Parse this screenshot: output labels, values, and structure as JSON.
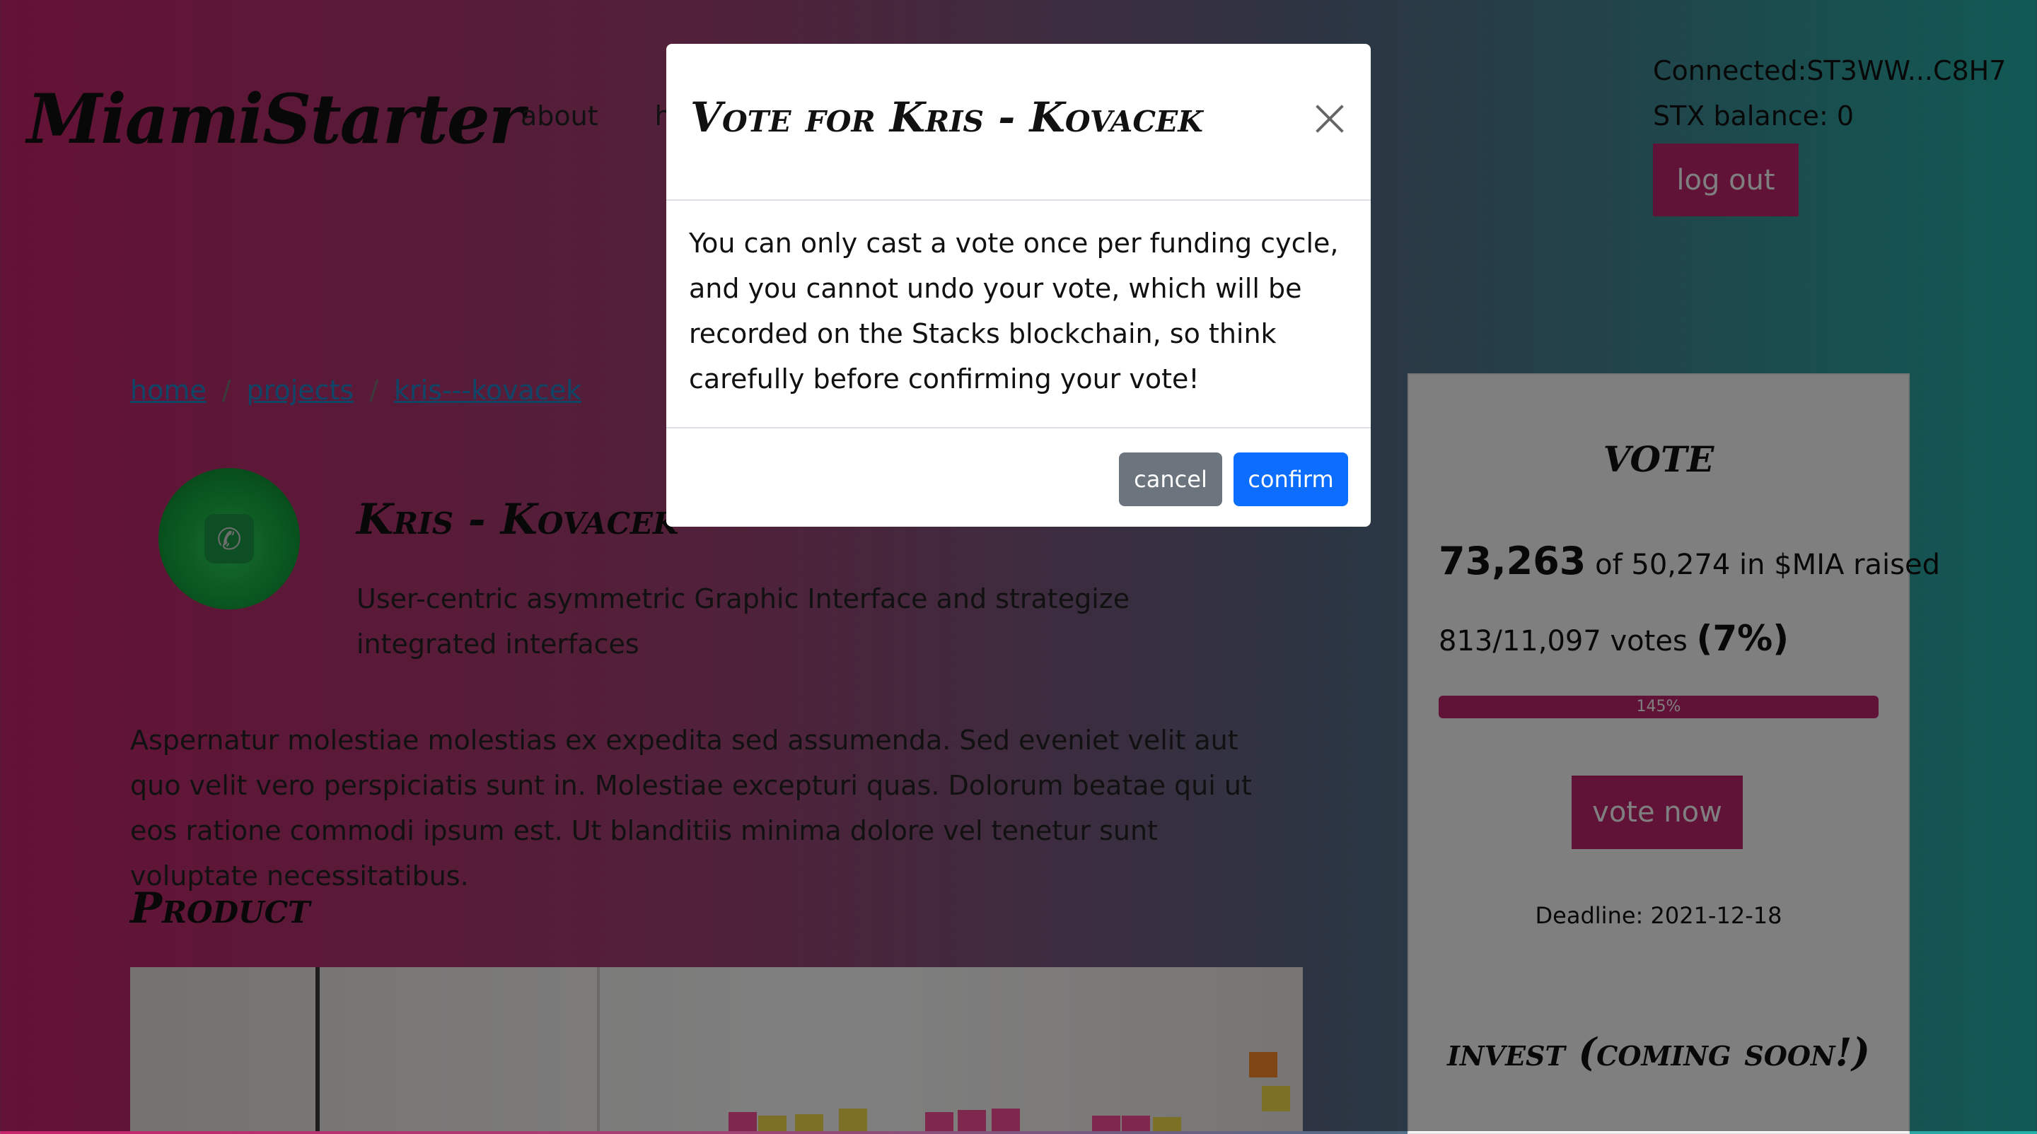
{
  "header": {
    "brand": "MiamiStarter",
    "nav": {
      "about": "about",
      "partial": "h"
    },
    "account": {
      "connected": "Connected:ST3WW...C8H7",
      "balance": "STX balance: 0",
      "logout_label": "log out"
    }
  },
  "breadcrumb": {
    "home": "home",
    "projects": "projects",
    "current": "kris---kovacek",
    "separator": "/"
  },
  "project": {
    "title": "Kris - Kovacek",
    "tagline": "User-centric asymmetric Graphic Interface and strategize integrated interfaces",
    "description": "Aspernatur molestiae molestias ex expedita sed assumenda. Sed eveniet velit aut quo velit vero perspiciatis sunt in. Molestiae excepturi quas. Dolorum beatae qui ut eos ratione commodi ipsum est. Ut blanditiis minima dolore vel tenetur sunt voluptate necessitatibus.",
    "product_heading": "Product"
  },
  "vote_card": {
    "heading": "VOTE",
    "raised_amount": "73,263",
    "raised_text": "of 50,274 in $MIA raised",
    "votes_text": "813/11,097 votes",
    "votes_percent": "(7%)",
    "progress_label": "145%",
    "progress_value": 145,
    "vote_now_label": "vote now",
    "deadline": "Deadline: 2021-12-18"
  },
  "invest_card": {
    "heading": "invest (coming soon!)"
  },
  "modal": {
    "title": "Vote for Kris - Kovacek",
    "body": "You can only cast a vote once per funding cycle, and you cannot undo your vote, which will be recorded on the Stacks blockchain, so think carefully before confirming your vote!",
    "cancel_label": "cancel",
    "confirm_label": "confirm"
  },
  "colors": {
    "brand_pink": "#c0266e",
    "confirm_blue": "#0d6efd",
    "cancel_gray": "#6c757d",
    "link_blue": "#1e8cd0"
  },
  "icons": {
    "avatar": "whatsapp-icon",
    "close": "close-icon"
  }
}
